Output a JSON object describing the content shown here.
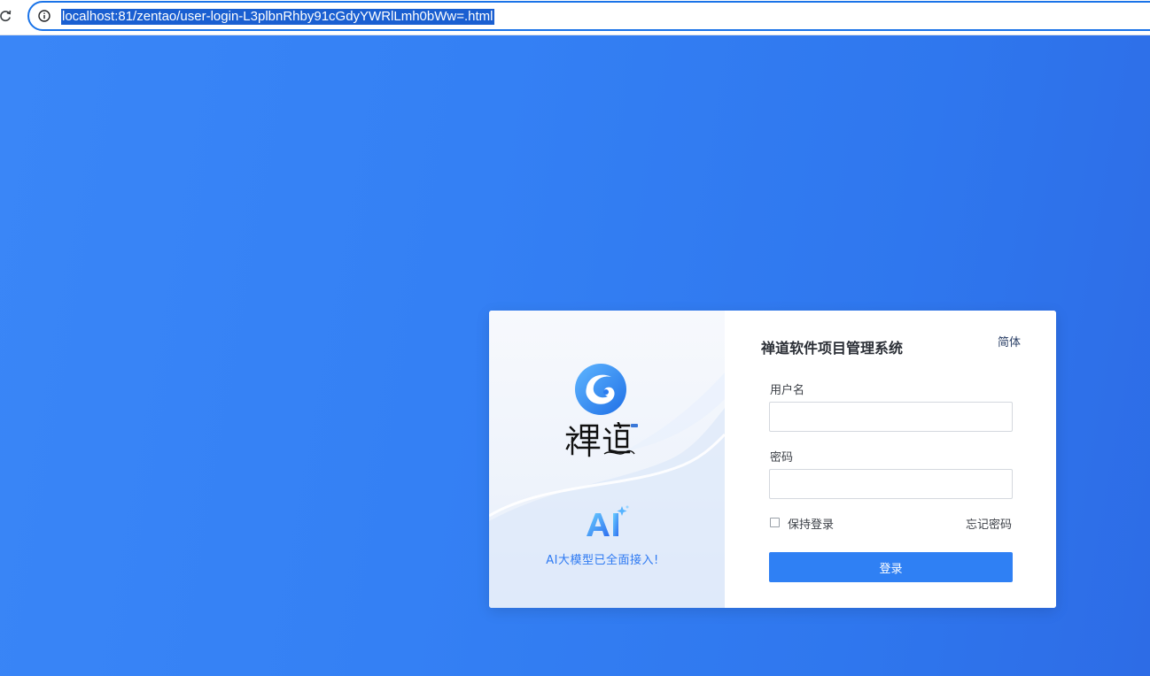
{
  "browser": {
    "url": "localhost:81/zentao/user-login-L3plbnRhby91cGdyYWRlLmh0bWw=.html",
    "icons": {
      "reload": "reload-icon",
      "info": "info-icon"
    }
  },
  "brand": {
    "ai_caption": "AI大模型已全面接入!"
  },
  "login": {
    "title": "禅道软件项目管理系统",
    "language": "简体",
    "username_label": "用户名",
    "username_value": "",
    "password_label": "密码",
    "password_value": "",
    "remember_label": "保持登录",
    "remember_checked": false,
    "forgot_label": "忘记密码",
    "submit_label": "登录"
  },
  "colors": {
    "background": "#2f74ee",
    "accent": "#2f80f4",
    "ai_text": "#2e7af2"
  }
}
